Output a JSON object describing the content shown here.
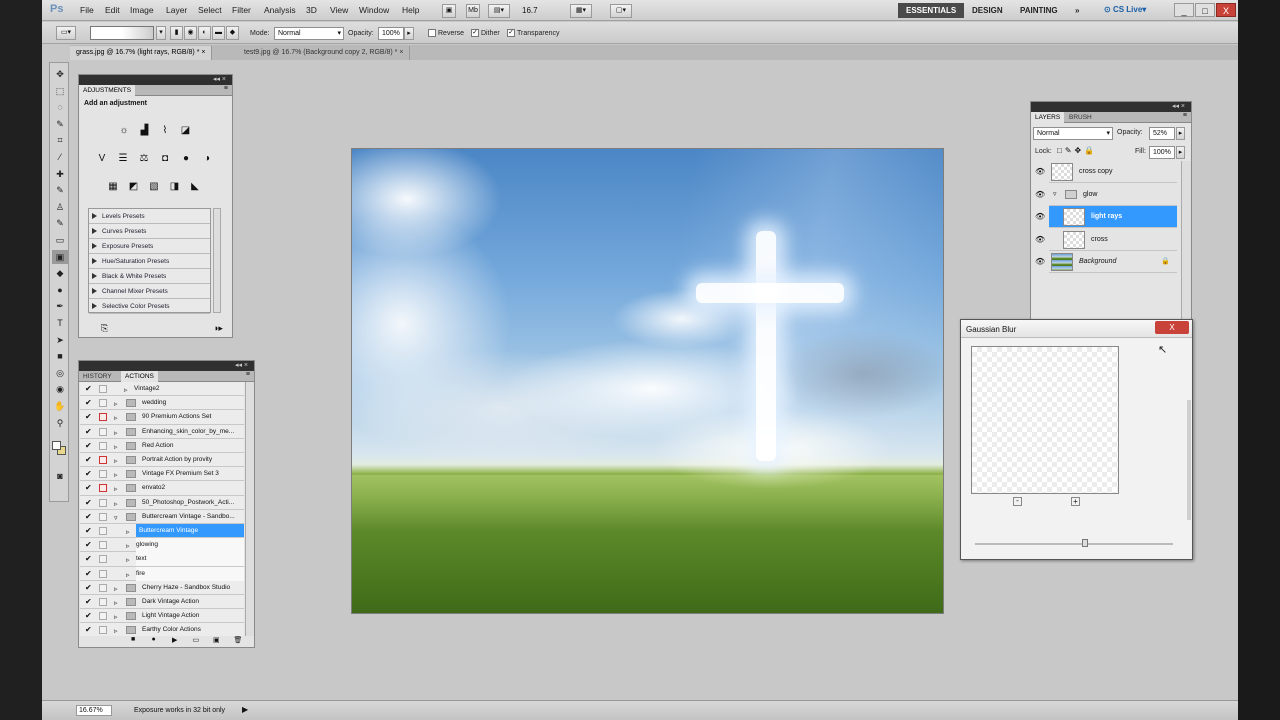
{
  "app": {
    "logo": "Ps"
  },
  "menu": [
    "File",
    "Edit",
    "Image",
    "Layer",
    "Select",
    "Filter",
    "Analysis",
    "3D",
    "View",
    "Window",
    "Help"
  ],
  "menubar_right": {
    "zoom_value": "16.7",
    "workspaces": [
      "ESSENTIALS",
      "DESIGN",
      "PAINTING"
    ],
    "more": "»",
    "cs_live": "CS Live",
    "win_min": "_",
    "win_max": "□",
    "win_close": "X"
  },
  "options": {
    "mode_label": "Mode:",
    "mode_value": "Normal",
    "opacity_label": "Opacity:",
    "opacity_value": "100%",
    "reverse_label": "Reverse",
    "dither_label": "Dither",
    "transparency_label": "Transparency",
    "reverse_checked": false,
    "dither_checked": true,
    "transparency_checked": true
  },
  "tabs": [
    {
      "label": "grass.jpg @ 16.7% (light rays, RGB/8) *",
      "close": "×"
    },
    {
      "label": "test9.jpg @ 16.7% (Background copy 2, RGB/8) *",
      "close": "×"
    }
  ],
  "toolbox": {
    "tools": [
      {
        "name": "move",
        "glyph": "✥"
      },
      {
        "name": "marquee",
        "glyph": "⬚"
      },
      {
        "name": "lasso",
        "glyph": "◌"
      },
      {
        "name": "quick-select",
        "glyph": "✎"
      },
      {
        "name": "crop",
        "glyph": "⌗"
      },
      {
        "name": "eyedropper",
        "glyph": "⁄"
      },
      {
        "name": "healing",
        "glyph": "✚"
      },
      {
        "name": "brush",
        "glyph": "✎"
      },
      {
        "name": "stamp",
        "glyph": "♙"
      },
      {
        "name": "history-brush",
        "glyph": "✎"
      },
      {
        "name": "eraser",
        "glyph": "▭"
      },
      {
        "name": "gradient",
        "glyph": "▣"
      },
      {
        "name": "blur",
        "glyph": "◆"
      },
      {
        "name": "dodge",
        "glyph": "●"
      },
      {
        "name": "pen",
        "glyph": "✒"
      },
      {
        "name": "type",
        "glyph": "T"
      },
      {
        "name": "path-select",
        "glyph": "➤"
      },
      {
        "name": "shape",
        "glyph": "■"
      },
      {
        "name": "3d-rotate",
        "glyph": "◎"
      },
      {
        "name": "3d-orbit",
        "glyph": "◉"
      },
      {
        "name": "hand",
        "glyph": "✋"
      },
      {
        "name": "zoom",
        "glyph": "⚲"
      }
    ]
  },
  "adjustments": {
    "tab": "ADJUSTMENTS",
    "title": "Add an adjustment",
    "icons_row1": [
      "☼",
      "▟",
      "⌇",
      "◪"
    ],
    "icons_row2": [
      "V",
      "☰",
      "⚖",
      "◘",
      "●",
      "◑"
    ],
    "icons_row3": [
      "▦",
      "◩",
      "▧",
      "◨",
      "◣"
    ],
    "presets": [
      "Levels Presets",
      "Curves Presets",
      "Exposure Presets",
      "Hue/Saturation Presets",
      "Black & White Presets",
      "Channel Mixer Presets",
      "Selective Color Presets"
    ]
  },
  "history_actions": {
    "tabs": [
      "HISTORY",
      "ACTIONS"
    ],
    "rows": [
      {
        "label": "Vintage2",
        "kind": "item",
        "red": false
      },
      {
        "label": "wedding",
        "kind": "set",
        "red": false
      },
      {
        "label": "90 Premium Actions Set",
        "kind": "set",
        "red": true
      },
      {
        "label": "Enhancing_skin_color_by_me...",
        "kind": "set",
        "red": false
      },
      {
        "label": "Red Action",
        "kind": "set",
        "red": false
      },
      {
        "label": "Portrait Action by provity",
        "kind": "set",
        "red": true
      },
      {
        "label": "Vintage FX Premium Set 3",
        "kind": "set",
        "red": false
      },
      {
        "label": "envato2",
        "kind": "set",
        "red": true
      },
      {
        "label": "50_Photoshop_Postwork_Acti...",
        "kind": "set",
        "red": false
      },
      {
        "label": "Buttercream Vintage - Sandbo...",
        "kind": "open-set",
        "red": false
      },
      {
        "label": "Buttercream Vintage",
        "kind": "selected",
        "red": false
      },
      {
        "label": "glowing",
        "kind": "sub",
        "red": false
      },
      {
        "label": "text",
        "kind": "sub",
        "red": false
      },
      {
        "label": "fire",
        "kind": "sub",
        "red": false
      },
      {
        "label": "Cherry Haze - Sandbox Studio",
        "kind": "set",
        "red": false
      },
      {
        "label": "Dark Vintage Action",
        "kind": "set",
        "red": false
      },
      {
        "label": "Light Vintage Action",
        "kind": "set",
        "red": false
      },
      {
        "label": "Earthy Color Actions",
        "kind": "set",
        "red": false
      }
    ],
    "controls": [
      "■",
      "●",
      "▶",
      "▭",
      "▣",
      "🗑"
    ]
  },
  "layers": {
    "tabs": [
      "LAYERS",
      "BRUSH"
    ],
    "blend": "Normal",
    "opacity_label": "Opacity:",
    "opacity_value": "52%",
    "lock_label": "Lock:",
    "fill_label": "Fill:",
    "fill_value": "100%",
    "rows": [
      {
        "name": "cross copy",
        "indent": 0,
        "kind": "layer",
        "selected": false
      },
      {
        "name": "glow",
        "indent": 0,
        "kind": "group",
        "selected": false
      },
      {
        "name": "light rays",
        "indent": 1,
        "kind": "layer",
        "selected": true
      },
      {
        "name": "cross",
        "indent": 1,
        "kind": "layer",
        "selected": false
      },
      {
        "name": "Background",
        "indent": 0,
        "kind": "background",
        "selected": false
      }
    ],
    "lock_icon": "🔒"
  },
  "dialog": {
    "title": "Gaussian Blur",
    "close": "X",
    "zoom_out": "-",
    "zoom_in": "+"
  },
  "status": {
    "zoom": "16.67%",
    "message": "Exposure works in 32 bit only"
  }
}
